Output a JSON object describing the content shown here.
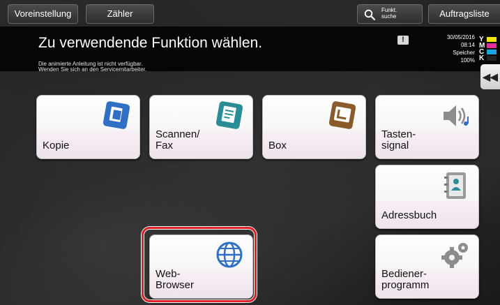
{
  "topbar": {
    "voreinstellung_label": "Voreinstellung",
    "zaehler_label": "Zähler",
    "funkt_line1": "Funkt.",
    "funkt_line2": "suche",
    "auftragsliste_label": "Auftragsliste"
  },
  "header": {
    "title": "Zu verwendende Funktion wählen.",
    "notice_line1": "Die animierte Anleitung ist nicht verfügbar.",
    "notice_line2": "Wenden Sie sich an den Servicemitarbeiter.",
    "info_symbol": "!",
    "date": "30/05/2016",
    "time": "08:14",
    "memory_label": "Speicher",
    "memory_value": "100%"
  },
  "toner": [
    {
      "letter": "Y",
      "color": "#f2e600"
    },
    {
      "letter": "M",
      "color": "#e0309a"
    },
    {
      "letter": "C",
      "color": "#19a6e0"
    },
    {
      "letter": "K",
      "color": "#222222"
    }
  ],
  "collapse_symbol": "◀◀",
  "tiles": {
    "kopie": "Kopie",
    "scannen": "Scannen/\nFax",
    "box": "Box",
    "tasten": "Tasten-\nsignal",
    "adress": "Adressbuch",
    "bediener": "Bediener-\nprogramm",
    "web": "Web-\nBrowser"
  },
  "colors": {
    "highlight": "#e0212a",
    "icon_blue": "#2f6fc4",
    "icon_teal": "#2a8c94",
    "icon_brown": "#8a5a2b",
    "icon_gray": "#8c8c8c"
  }
}
